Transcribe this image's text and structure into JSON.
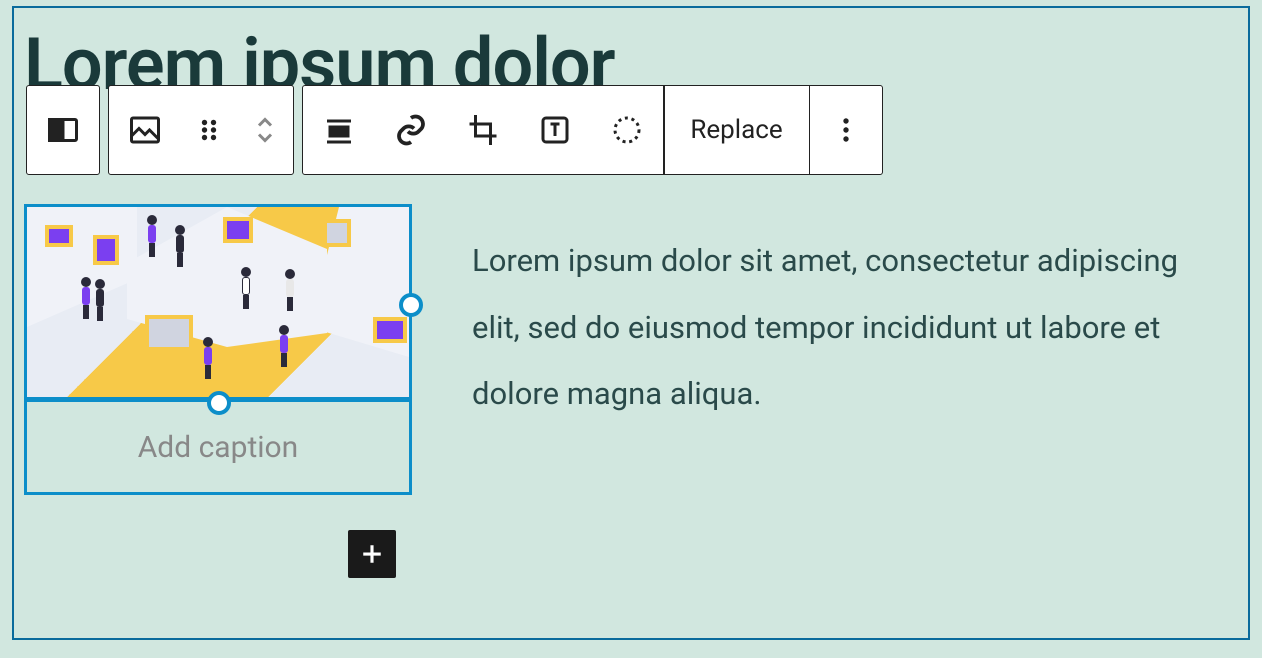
{
  "heading": "Lorem ipsum dolor",
  "toolbar": {
    "replace_label": "Replace"
  },
  "image_block": {
    "caption_placeholder": "Add caption"
  },
  "paragraph": "Lorem ipsum dolor sit amet, consectetur adipiscing elit, sed do eiusmod tempor incididunt ut labore et dolore magna aliqua.",
  "colors": {
    "selection": "#0c8ec9",
    "canvas_bg": "#d1e7df",
    "accent_yellow": "#f7c948",
    "accent_purple": "#7b3ff0"
  }
}
